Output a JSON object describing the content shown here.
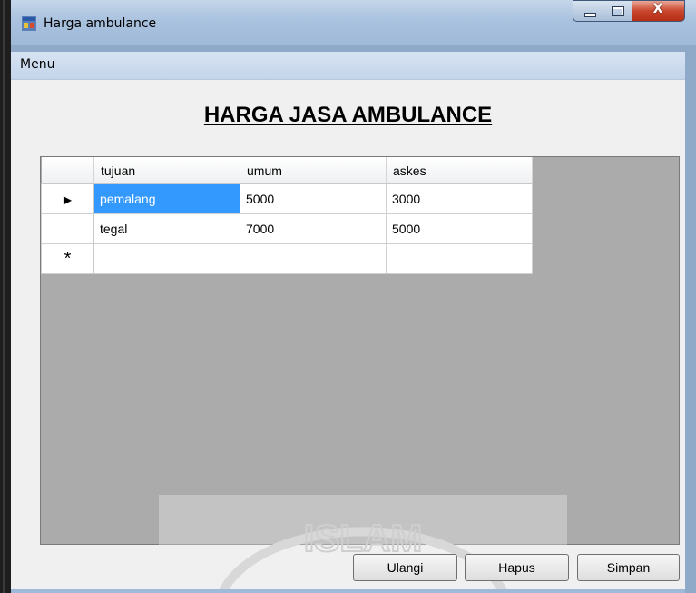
{
  "window": {
    "title": "Harga ambulance",
    "close_glyph": "X"
  },
  "menu": {
    "items": [
      {
        "label": "Menu"
      }
    ]
  },
  "form": {
    "heading": "HARGA JASA AMBULANCE"
  },
  "grid": {
    "columns": [
      "tujuan",
      "umum",
      "askes"
    ],
    "rows": [
      {
        "marker": "▶",
        "cells": [
          "pemalang",
          "5000",
          "3000"
        ],
        "selected_col": 0
      },
      {
        "marker": "",
        "cells": [
          "tegal",
          "7000",
          "5000"
        ]
      },
      {
        "marker": "*",
        "cells": [
          "",
          "",
          ""
        ]
      }
    ]
  },
  "buttons": {
    "ulangi": "Ulangi",
    "hapus": "Hapus",
    "simpan": "Simpan"
  },
  "watermark": {
    "text": "ISLAM"
  },
  "colors": {
    "selection": "#3399ff",
    "grid_background": "#ababab",
    "title_bar": "#a9c2df",
    "close_button": "#c9462d"
  }
}
